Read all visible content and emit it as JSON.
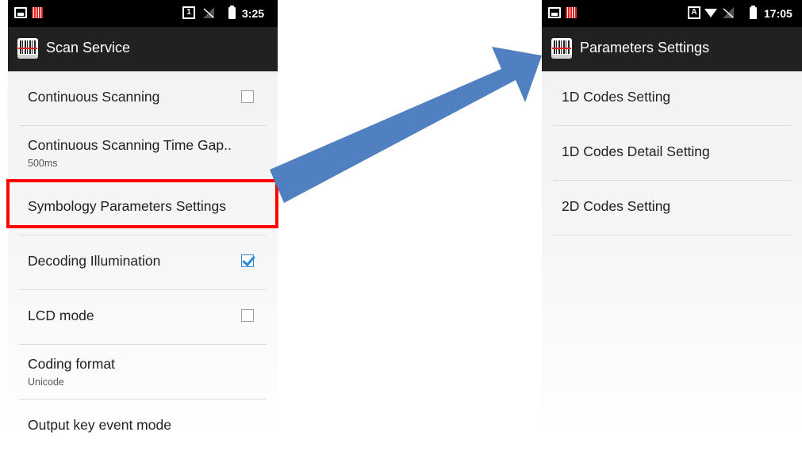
{
  "left_screen": {
    "status_bar": {
      "icons": [
        "image-notification-icon",
        "barcode-notification-icon",
        "sim-1-icon",
        "no-signal-icon",
        "battery-icon"
      ],
      "sim_label": "1",
      "time": "3:25"
    },
    "action_bar": {
      "title": "Scan Service",
      "icon": "barcode-scanner-icon"
    },
    "preferences": [
      {
        "title": "Continuous Scanning",
        "checkbox": true,
        "checked": false
      },
      {
        "title": "Continuous Scanning Time Gap..",
        "summary": "500ms"
      },
      {
        "title": "Symbology Parameters Settings",
        "highlighted": true
      },
      {
        "title": "Decoding Illumination",
        "checkbox": true,
        "checked": true
      },
      {
        "title": "LCD mode",
        "checkbox": true,
        "checked": false
      },
      {
        "title": "Coding format",
        "summary": "Unicode"
      },
      {
        "title": "Output key event mode"
      }
    ]
  },
  "right_screen": {
    "status_bar": {
      "icons": [
        "image-notification-icon",
        "barcode-notification-icon",
        "keyboard-a-icon",
        "wifi-icon",
        "no-signal-icon",
        "battery-icon"
      ],
      "input_label": "A",
      "time": "17:05"
    },
    "action_bar": {
      "title": "Parameters Settings",
      "icon": "barcode-scanner-icon"
    },
    "preferences": [
      {
        "title": "1D Codes Setting"
      },
      {
        "title": "1D Codes Detail Setting"
      },
      {
        "title": "2D Codes Setting"
      }
    ]
  },
  "annotation": {
    "highlight_color": "#ff0000",
    "arrow_color": "#5080c0",
    "arrow_meaning": "navigate-to"
  },
  "colors": {
    "status_bar": "#000000",
    "action_bar": "#212121",
    "checkbox_checked": "#2b88d8"
  }
}
